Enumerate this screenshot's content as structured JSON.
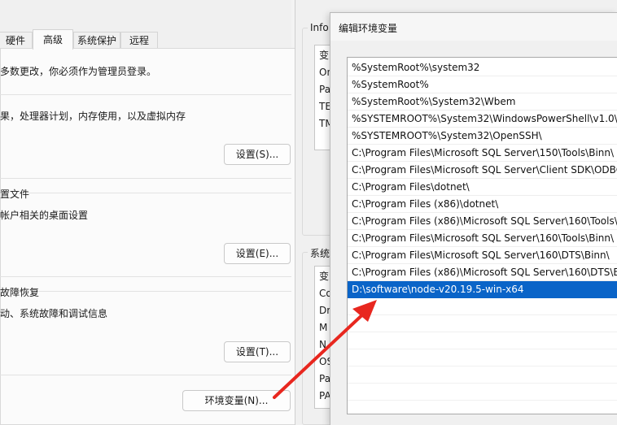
{
  "system_properties": {
    "tabs": [
      {
        "label": "硬件"
      },
      {
        "label": "高级",
        "active": true
      },
      {
        "label": "系统保护"
      },
      {
        "label": "远程"
      }
    ],
    "admin_notice": "多数更改，你必须作为管理员登录。",
    "performance": {
      "description": "果，处理器计划，内存使用，以及虚拟内存",
      "settings_button": "设置(S)..."
    },
    "user_profiles": {
      "heading": "置文件",
      "description": "帐户相关的桌面设置",
      "settings_button": "设置(E)..."
    },
    "startup_recovery": {
      "heading": "故障恢复",
      "description": "动、系统故障和调试信息",
      "settings_button": "设置(T)..."
    },
    "env_vars_button": "环境变量(N)..."
  },
  "env_vars_dialog": {
    "user_group_label": "Info",
    "user_list_fragments": [
      "变",
      "On",
      "Pa",
      "TE",
      "TM"
    ],
    "system_group_label": "系统",
    "system_list_fragments": [
      "变",
      "Co",
      "Dr",
      "M",
      "N",
      "OS",
      "Pa",
      "PA"
    ]
  },
  "edit_dialog": {
    "title": "编辑环境变量",
    "path_entries": [
      "%SystemRoot%\\system32",
      "%SystemRoot%",
      "%SystemRoot%\\System32\\Wbem",
      "%SYSTEMROOT%\\System32\\WindowsPowerShell\\v1.0\\",
      "%SYSTEMROOT%\\System32\\OpenSSH\\",
      "C:\\Program Files\\Microsoft SQL Server\\150\\Tools\\Binn\\",
      "C:\\Program Files\\Microsoft SQL Server\\Client SDK\\ODBC",
      "C:\\Program Files\\dotnet\\",
      "C:\\Program Files (x86)\\dotnet\\",
      "C:\\Program Files (x86)\\Microsoft SQL Server\\160\\Tools\\",
      "C:\\Program Files\\Microsoft SQL Server\\160\\Tools\\Binn\\",
      "C:\\Program Files\\Microsoft SQL Server\\160\\DTS\\Binn\\",
      "C:\\Program Files (x86)\\Microsoft SQL Server\\160\\DTS\\Bi",
      "D:\\software\\node-v20.19.5-win-x64"
    ],
    "selected_index": 13
  },
  "annotation": {
    "arrow_color": "#e8271f"
  }
}
